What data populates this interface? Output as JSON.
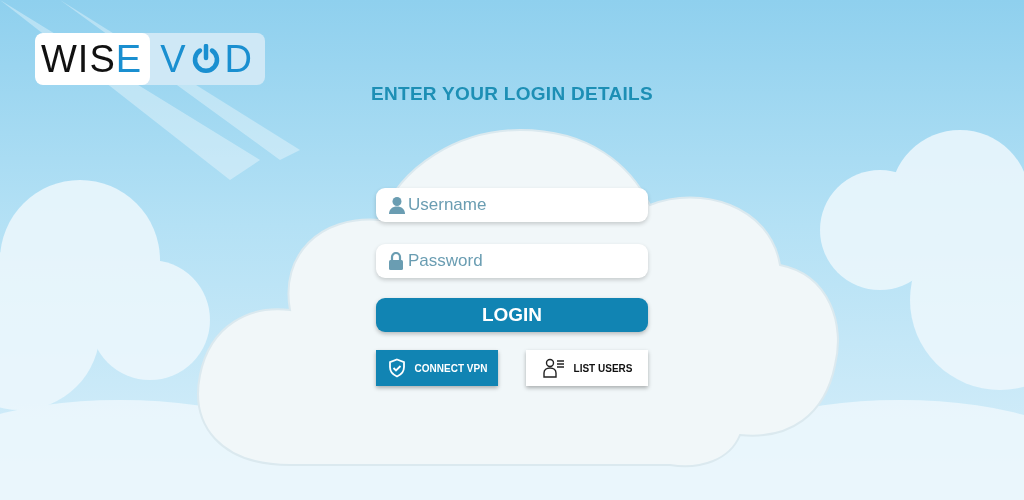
{
  "logo": {
    "dark_part": "WIS",
    "accent_part": "E",
    "before_icon": "V",
    "after_icon": "D"
  },
  "title": "ENTER YOUR LOGIN DETAILS",
  "fields": [
    {
      "kind": "user",
      "placeholder": "Username"
    },
    {
      "kind": "lock",
      "placeholder": "Password"
    }
  ],
  "login_button": "LOGIN",
  "buttons": [
    {
      "kind": "shield",
      "label": "CONNECT VPN"
    },
    {
      "kind": "users",
      "label": "LIST USERS"
    }
  ]
}
